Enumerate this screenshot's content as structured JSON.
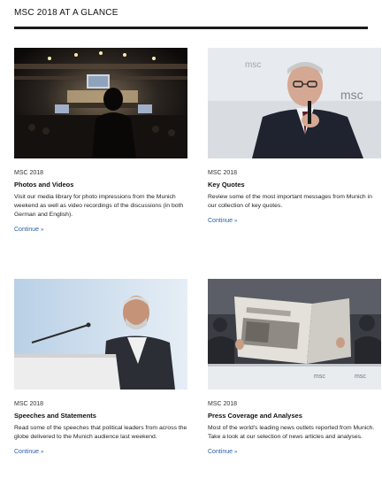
{
  "header": {
    "title": "MSC 2018 AT A GLANCE"
  },
  "cards": [
    {
      "kicker": "MSC 2018",
      "heading": "Photos and Videos",
      "body": "Visit our media library for photo impressions from the Munich weekend as well as video recordings of the discussions (in both German and English).",
      "link": "Continue"
    },
    {
      "kicker": "MSC 2018",
      "heading": "Key Quotes",
      "body": "Review some of the most important messages from Munich in our collection of key quotes.",
      "link": "Continue"
    },
    {
      "kicker": "MSC 2018",
      "heading": "Speeches and Statements",
      "body": "Read some of the speeches that political leaders from across the globe delivered to the Munich audience last weekend.",
      "link": "Continue"
    },
    {
      "kicker": "MSC 2018",
      "heading": "Press Coverage and Analyses",
      "body": "Most of the world's leading news outlets reported from Munich. Take a look at our selection of news articles and analyses.",
      "link": "Continue"
    }
  ],
  "photo_text": {
    "msc_wordmark": "msc"
  },
  "colors": {
    "link": "#2a5fa8",
    "rule": "#1b1b1b"
  }
}
